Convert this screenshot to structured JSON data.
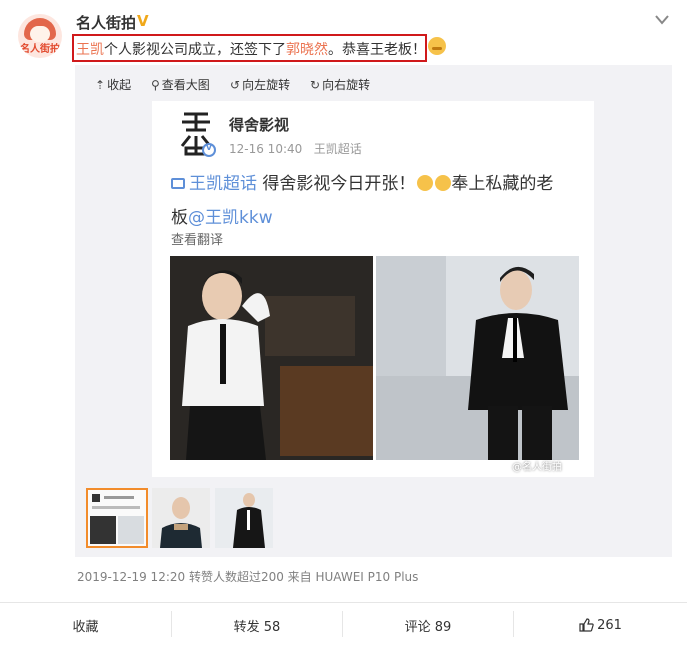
{
  "post": {
    "author": "名人街拍",
    "verified_mark": "V",
    "avatar_text": "名人街拍",
    "text_parts": [
      "王凯",
      "个人影视公司成立，还签下了",
      "郭晓然",
      "。恭喜王老板！"
    ]
  },
  "toolbar": {
    "collapse": "收起",
    "view_large": "查看大图",
    "rotate_left": "向左旋转",
    "rotate_right": "向右旋转"
  },
  "repost": {
    "name": "得舍影视",
    "time": "12-16 10:40",
    "topic_source": "王凯超话",
    "topic": "王凯超话",
    "body_line1": "得舍影视今日开张！",
    "body_line1_end": "奉上私藏的老",
    "body_line2_prefix": "板",
    "mention": "@王凯kkw",
    "translate": "查看翻译",
    "watermark": "@名人街拍"
  },
  "meta": "2019-12-19 12:20 转赞人数超过200 来自 HUAWEI P10 Plus",
  "actions": {
    "favorite": "收藏",
    "repost": "转发 58",
    "comment": "评论 89",
    "like": "261"
  },
  "colors": {
    "highlight": "#eb7350",
    "link": "#5e8fd8",
    "box": "#d0191b",
    "verified": "#f0a81a"
  }
}
